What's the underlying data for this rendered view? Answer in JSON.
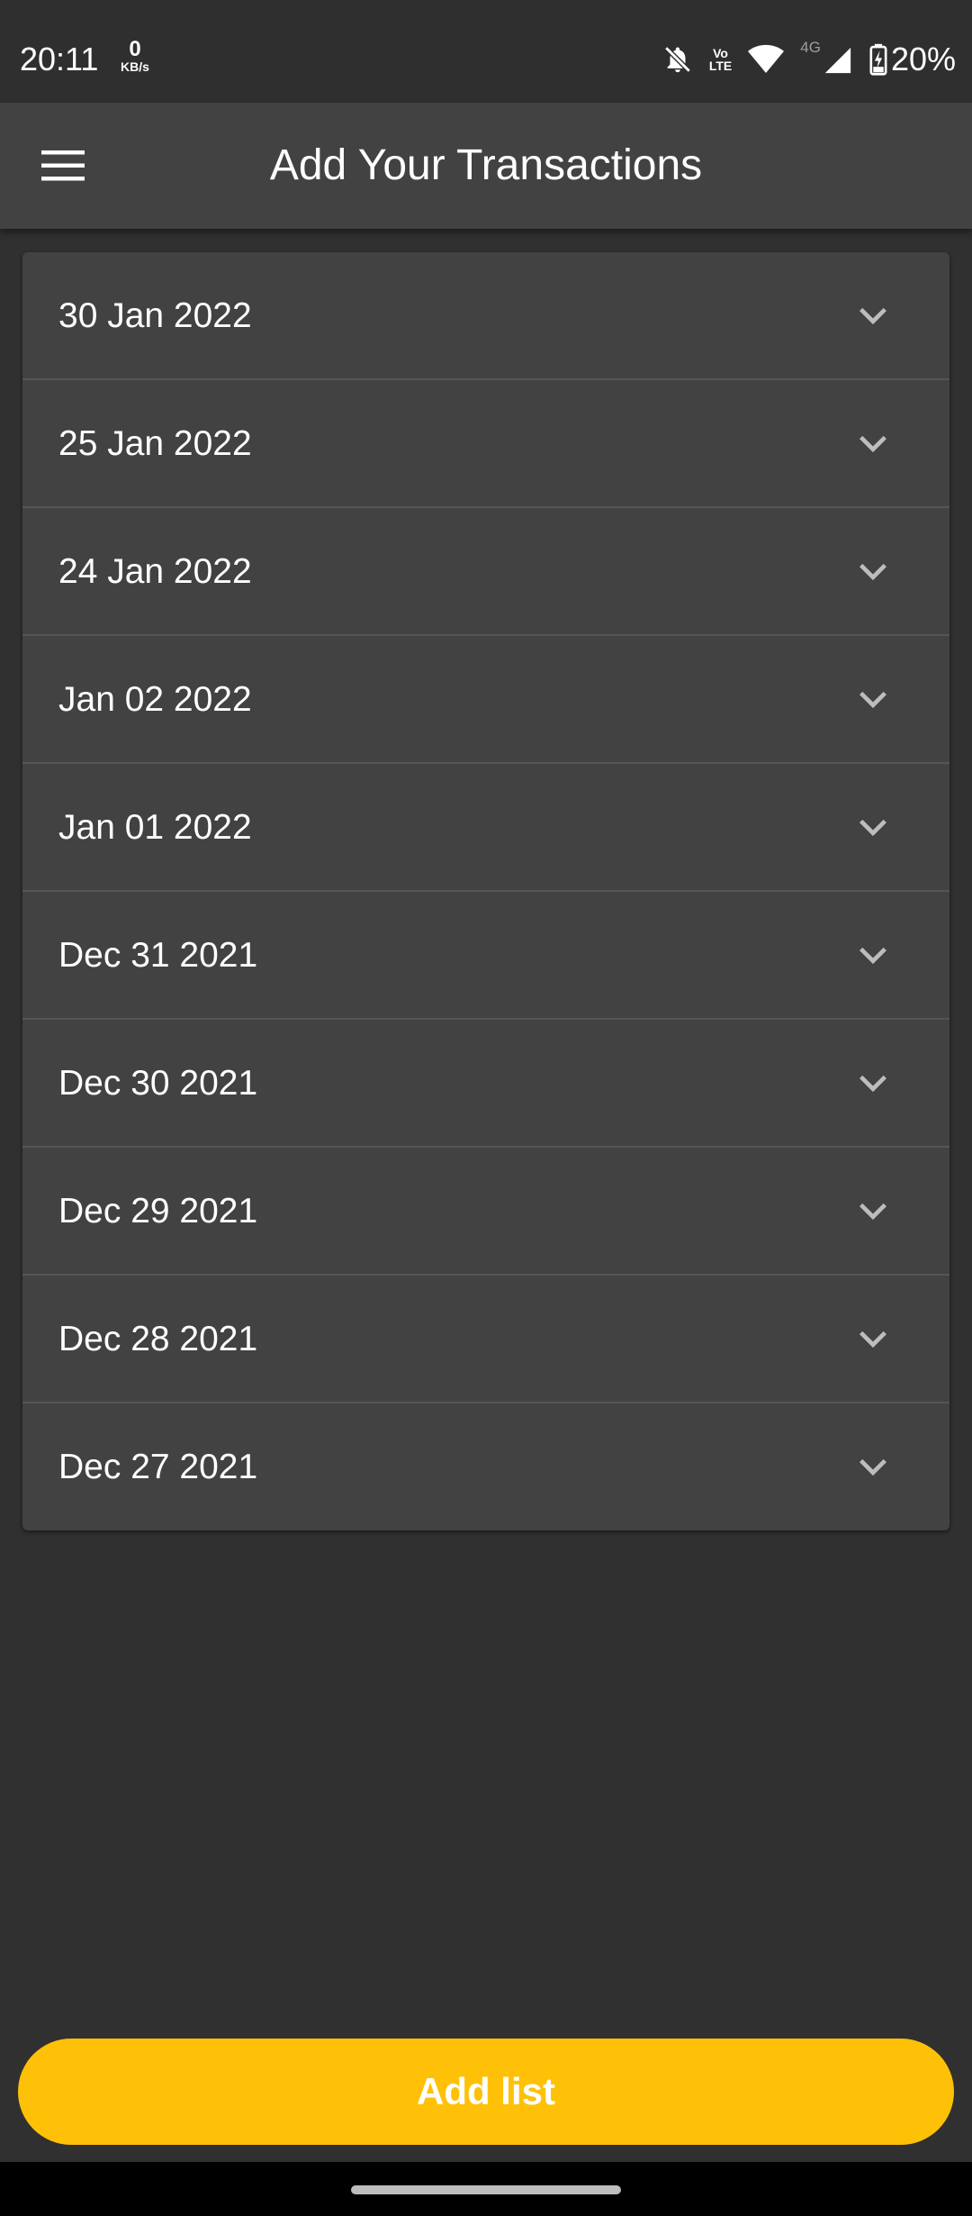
{
  "status_bar": {
    "time": "20:11",
    "net_speed_value": "0",
    "net_speed_unit": "KB/s",
    "volte_top": "Vo",
    "volte_bottom": "LTE",
    "network_type": "4G",
    "battery": "20%",
    "icons": [
      "bell-off-icon",
      "volte-icon",
      "wifi-icon",
      "signal-icon",
      "battery-charging-icon"
    ]
  },
  "app_bar": {
    "title": "Add Your Transactions",
    "menu_icon": "menu-icon"
  },
  "dates": [
    {
      "label": "30 Jan 2022"
    },
    {
      "label": "25 Jan 2022"
    },
    {
      "label": "24 Jan 2022"
    },
    {
      "label": "Jan 02 2022"
    },
    {
      "label": "Jan 01 2022"
    },
    {
      "label": "Dec 31 2021"
    },
    {
      "label": "Dec 30 2021"
    },
    {
      "label": "Dec 29 2021"
    },
    {
      "label": "Dec 28 2021"
    },
    {
      "label": "Dec 27 2021"
    }
  ],
  "add_button": {
    "label": "Add list"
  },
  "colors": {
    "background": "#303030",
    "surface": "#424242",
    "accent": "#ffc107",
    "text": "#ffffff"
  }
}
